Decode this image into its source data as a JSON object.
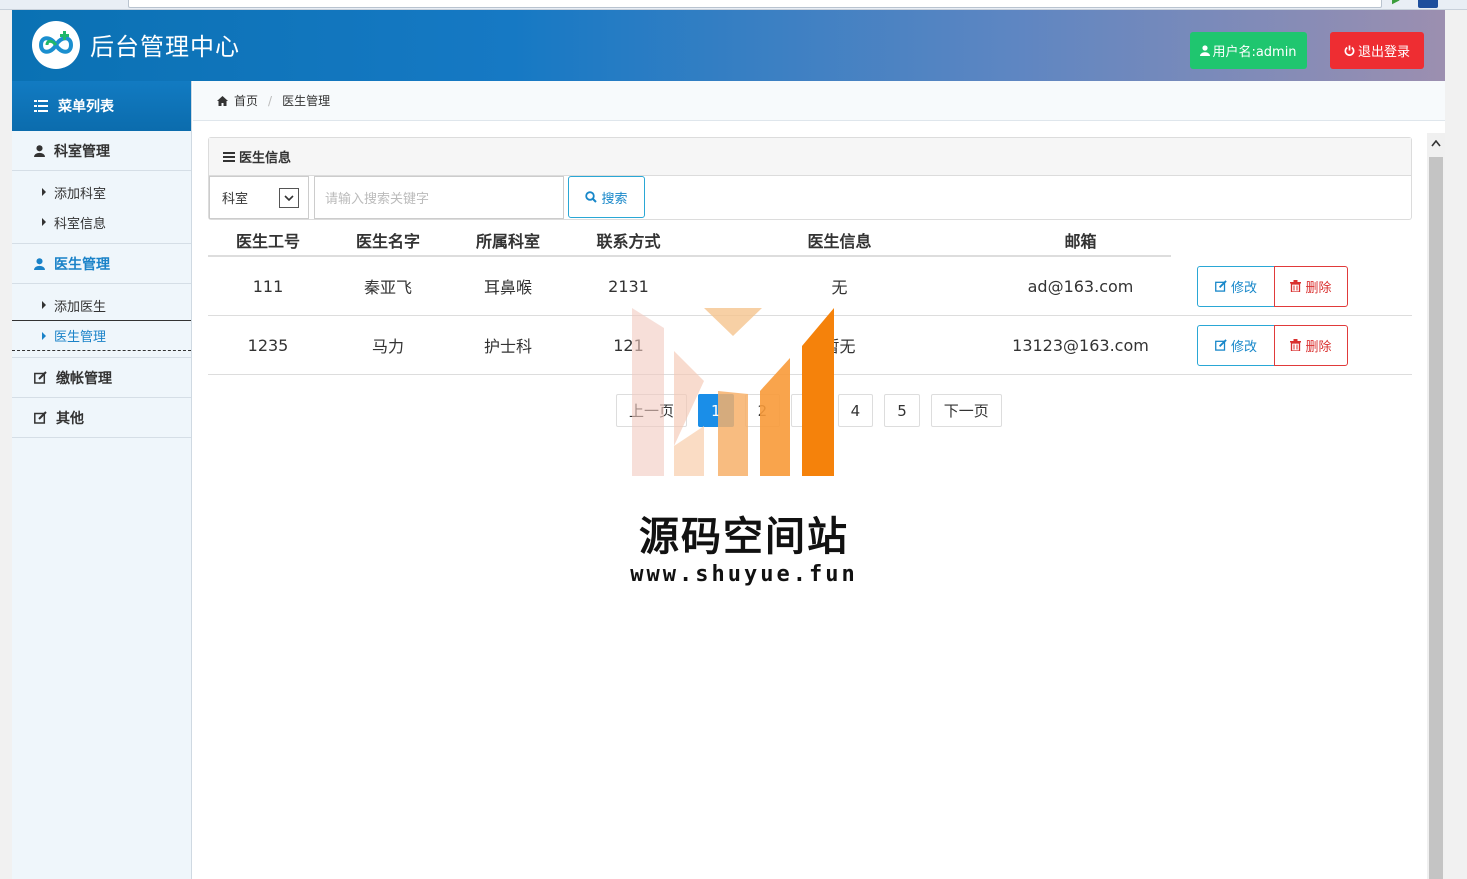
{
  "header": {
    "title": "后台管理中心",
    "user_label": "用户名:admin",
    "logout_label": "退出登录"
  },
  "sidebar": {
    "heading": "菜单列表",
    "groups": [
      {
        "label": "科室管理",
        "items": [
          "添加科室",
          "科室信息"
        ]
      },
      {
        "label": "医生管理",
        "items": [
          "添加医生",
          "医生管理"
        ]
      },
      {
        "label": "缴帐管理"
      },
      {
        "label": "其他"
      }
    ]
  },
  "breadcrumb": {
    "home": "首页",
    "current": "医生管理"
  },
  "panel": {
    "title": "医生信息",
    "select_value": "科室",
    "search_placeholder": "请输入搜索关键字",
    "search_label": "搜索"
  },
  "table": {
    "columns": [
      "医生工号",
      "医生名字",
      "所属科室",
      "联系方式",
      "医生信息",
      "邮箱"
    ],
    "rows": [
      {
        "id": "111",
        "name": "秦亚飞",
        "dept": "耳鼻喉",
        "contact": "2131",
        "info": "无",
        "email": "ad@163.com"
      },
      {
        "id": "1235",
        "name": "马力",
        "dept": "护士科",
        "contact": "121",
        "info": "暂无",
        "email": "13123@163.com"
      }
    ],
    "edit_label": "修改",
    "delete_label": "删除"
  },
  "pagination": {
    "prev": "上一页",
    "pages": [
      "1",
      "2",
      "3",
      "4",
      "5"
    ],
    "current": "1",
    "next": "下一页"
  },
  "watermark": {
    "name": "源码空间站",
    "url": "www.shuyue.fun"
  },
  "colors": {
    "header_start": "#0a71b3",
    "accent": "#1a82c8",
    "user_button": "#1fc66f",
    "logout_button": "#ee2d32",
    "active_page": "#1a8ee8"
  }
}
